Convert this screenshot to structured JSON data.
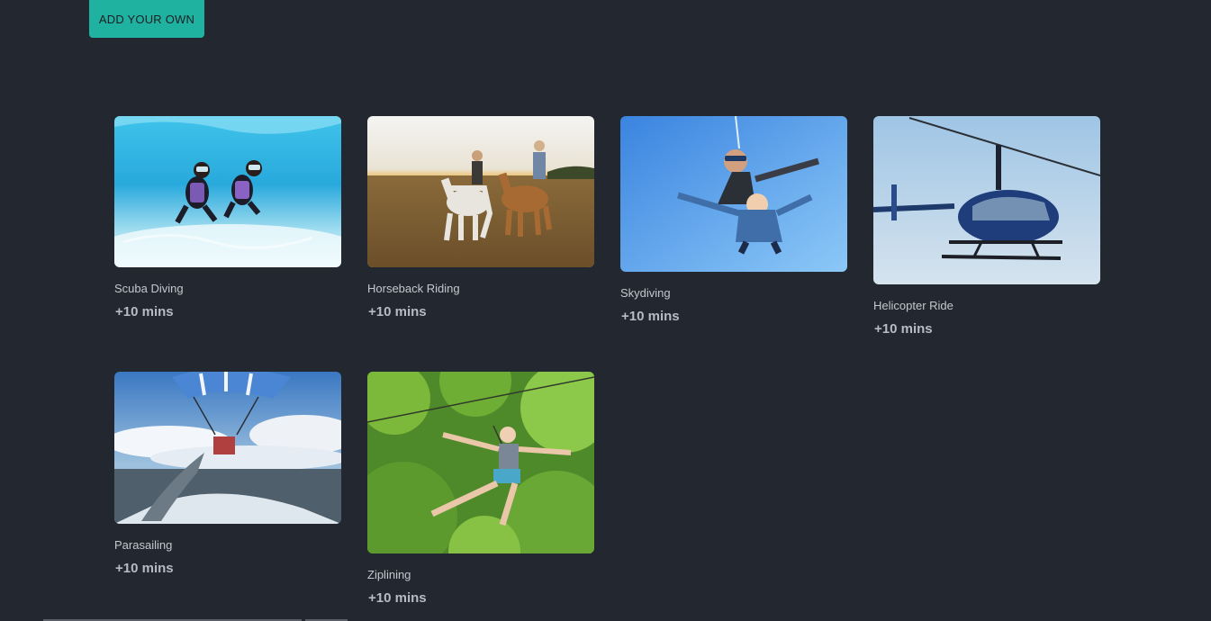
{
  "toolbar": {
    "add_label": "ADD YOUR OWN"
  },
  "activities": [
    {
      "name": "Scuba Diving",
      "time": "+10 mins",
      "image": "scuba-divers-underwater"
    },
    {
      "name": "Horseback Riding",
      "time": "+10 mins",
      "image": "riders-on-horses-in-field"
    },
    {
      "name": "Skydiving",
      "time": "+10 mins",
      "image": "tandem-skydivers-in-sky"
    },
    {
      "name": "Helicopter Ride",
      "time": "+10 mins",
      "image": "blue-helicopter-in-flight"
    },
    {
      "name": "Parasailing",
      "time": "+10 mins",
      "image": "parasail-over-water"
    },
    {
      "name": "Ziplining",
      "time": "+10 mins",
      "image": "person-on-zipline-over-forest"
    }
  ],
  "colors": {
    "background": "#23272f",
    "accent": "#20b2a0",
    "label": "#c3c8cf"
  }
}
